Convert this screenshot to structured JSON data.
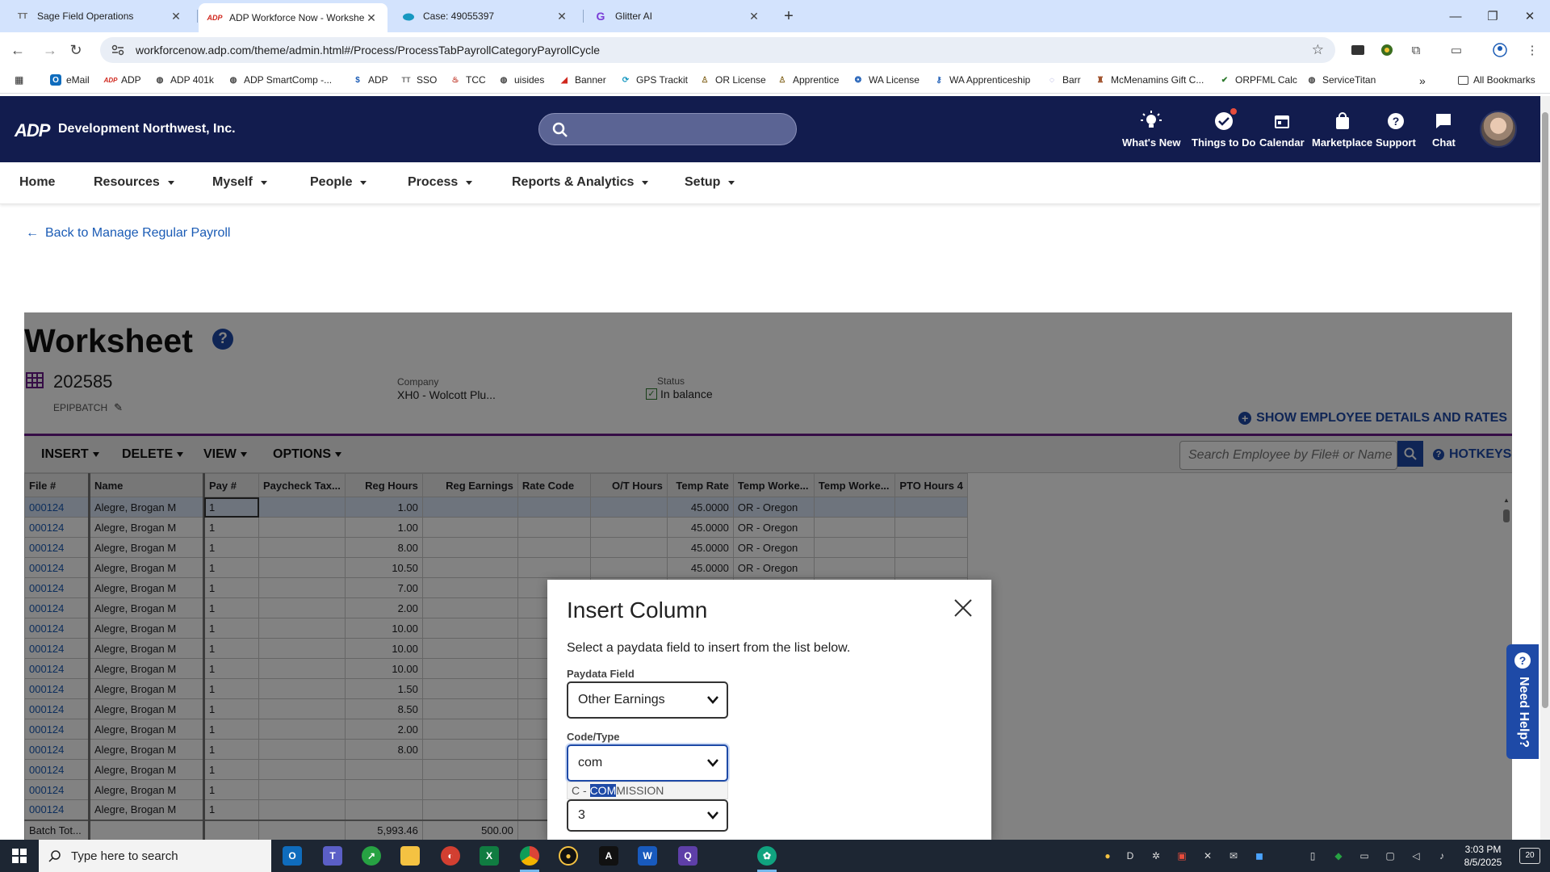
{
  "browser": {
    "tabs": [
      {
        "title": "Sage Field Operations",
        "favicon": "TT"
      },
      {
        "title": "ADP Workforce Now - Workshe",
        "favicon": "ADP"
      },
      {
        "title": "Case: 49055397",
        "favicon": "cloud"
      },
      {
        "title": "Glitter AI",
        "favicon": "G"
      }
    ],
    "url": "workforcenow.adp.com/theme/admin.html#/Process/ProcessTabPayrollCategoryPayrollCycle",
    "bookmarks": [
      "eMail",
      "ADP",
      "ADP 401k",
      "ADP SmartComp -...",
      "ADP",
      "SSO",
      "TCC",
      "uisides",
      "Banner",
      "GPS Trackit",
      "OR License",
      "Apprentice",
      "WA License",
      "WA Apprenticeship",
      "Barr",
      "McMenamins Gift C...",
      "ORPFML Calc",
      "ServiceTitan"
    ],
    "all_bookmarks": "All Bookmarks",
    "more": "»"
  },
  "adp": {
    "logo": "ADP",
    "company": "Development Northwest, Inc.",
    "header_items": [
      "What's New",
      "Things to Do",
      "Calendar",
      "Marketplace",
      "Support",
      "Chat"
    ],
    "nav": [
      "Home",
      "Resources",
      "Myself",
      "People",
      "Process",
      "Reports & Analytics",
      "Setup"
    ],
    "back_link": "Back to Manage Regular Payroll"
  },
  "worksheet": {
    "title": "Worksheet",
    "help": "?",
    "batch_number": "202585",
    "batch_sub": "EPIPBATCH",
    "company_label": "Company",
    "company_value": "XH0 - Wolcott Plu...",
    "status_label": "Status",
    "status_value": "In balance",
    "show_details": "SHOW EMPLOYEE DETAILS AND RATES",
    "toolbar": [
      "INSERT",
      "DELETE",
      "VIEW",
      "OPTIONS"
    ],
    "search_placeholder": "Search Employee by File# or Name",
    "hotkeys": "HOTKEYS",
    "columns": [
      "File #",
      "Name",
      "Pay #",
      "Paycheck Tax...",
      "Reg Hours",
      "Reg Earnings",
      "Rate Code",
      "O/T Hours",
      "Temp Rate",
      "Temp Worke...",
      "Temp Worke...",
      "PTO Hours 4"
    ],
    "rows": [
      [
        "000124",
        "Alegre, Brogan M",
        "1",
        "",
        "1.00",
        "",
        "",
        "",
        "45.0000",
        "OR - Oregon",
        "",
        ""
      ],
      [
        "000124",
        "Alegre, Brogan M",
        "1",
        "",
        "1.00",
        "",
        "",
        "",
        "45.0000",
        "OR - Oregon",
        "",
        ""
      ],
      [
        "000124",
        "Alegre, Brogan M",
        "1",
        "",
        "8.00",
        "",
        "",
        "",
        "45.0000",
        "OR - Oregon",
        "",
        ""
      ],
      [
        "000124",
        "Alegre, Brogan M",
        "1",
        "",
        "10.50",
        "",
        "",
        "",
        "45.0000",
        "OR - Oregon",
        "",
        ""
      ],
      [
        "000124",
        "Alegre, Brogan M",
        "1",
        "",
        "7.00",
        "",
        "",
        "",
        "",
        "",
        "",
        ""
      ],
      [
        "000124",
        "Alegre, Brogan M",
        "1",
        "",
        "2.00",
        "",
        "",
        "",
        "",
        "",
        "",
        ""
      ],
      [
        "000124",
        "Alegre, Brogan M",
        "1",
        "",
        "10.00",
        "",
        "",
        "",
        "",
        "",
        "",
        ""
      ],
      [
        "000124",
        "Alegre, Brogan M",
        "1",
        "",
        "10.00",
        "",
        "",
        "",
        "",
        "",
        "",
        ""
      ],
      [
        "000124",
        "Alegre, Brogan M",
        "1",
        "",
        "10.00",
        "",
        "",
        "",
        "",
        "",
        "",
        ""
      ],
      [
        "000124",
        "Alegre, Brogan M",
        "1",
        "",
        "1.50",
        "",
        "",
        "",
        "",
        "",
        "",
        ""
      ],
      [
        "000124",
        "Alegre, Brogan M",
        "1",
        "",
        "8.50",
        "",
        "",
        "",
        "",
        "",
        "",
        ""
      ],
      [
        "000124",
        "Alegre, Brogan M",
        "1",
        "",
        "2.00",
        "",
        "",
        "",
        "",
        "",
        "",
        ""
      ],
      [
        "000124",
        "Alegre, Brogan M",
        "1",
        "",
        "8.00",
        "",
        "",
        "",
        "",
        "",
        "",
        ""
      ],
      [
        "000124",
        "Alegre, Brogan M",
        "1",
        "",
        "",
        "",
        "",
        "",
        "",
        "",
        "",
        ""
      ],
      [
        "000124",
        "Alegre, Brogan M",
        "1",
        "",
        "",
        "",
        "",
        "",
        "",
        "",
        "",
        ""
      ],
      [
        "000124",
        "Alegre, Brogan M",
        "1",
        "",
        "",
        "",
        "",
        "",
        "",
        "",
        "",
        ""
      ]
    ],
    "total_row": [
      "Batch Tot...",
      "",
      "",
      "",
      "5,993.46",
      "500.00",
      "",
      "",
      "",
      "",
      "",
      ""
    ]
  },
  "modal": {
    "title": "Insert Column",
    "description": "Select a paydata field to insert from the list below.",
    "paydata_label": "Paydata Field",
    "paydata_value": "Other Earnings",
    "code_label": "Code/Type",
    "code_value": "com",
    "suggestion_prefix": "C - ",
    "suggestion_match": "COM",
    "suggestion_rest": "MISSION",
    "third_value": "3"
  },
  "need_help": "Need Help?",
  "taskbar": {
    "search_placeholder": "Type here to search",
    "time": "3:03 PM",
    "date": "8/5/2025",
    "notifications": "20"
  },
  "colors": {
    "adp_header": "#121c4e",
    "link": "#1a5bb5",
    "accent": "#1e4aa7",
    "purple_rule": "#6a1b8a"
  }
}
